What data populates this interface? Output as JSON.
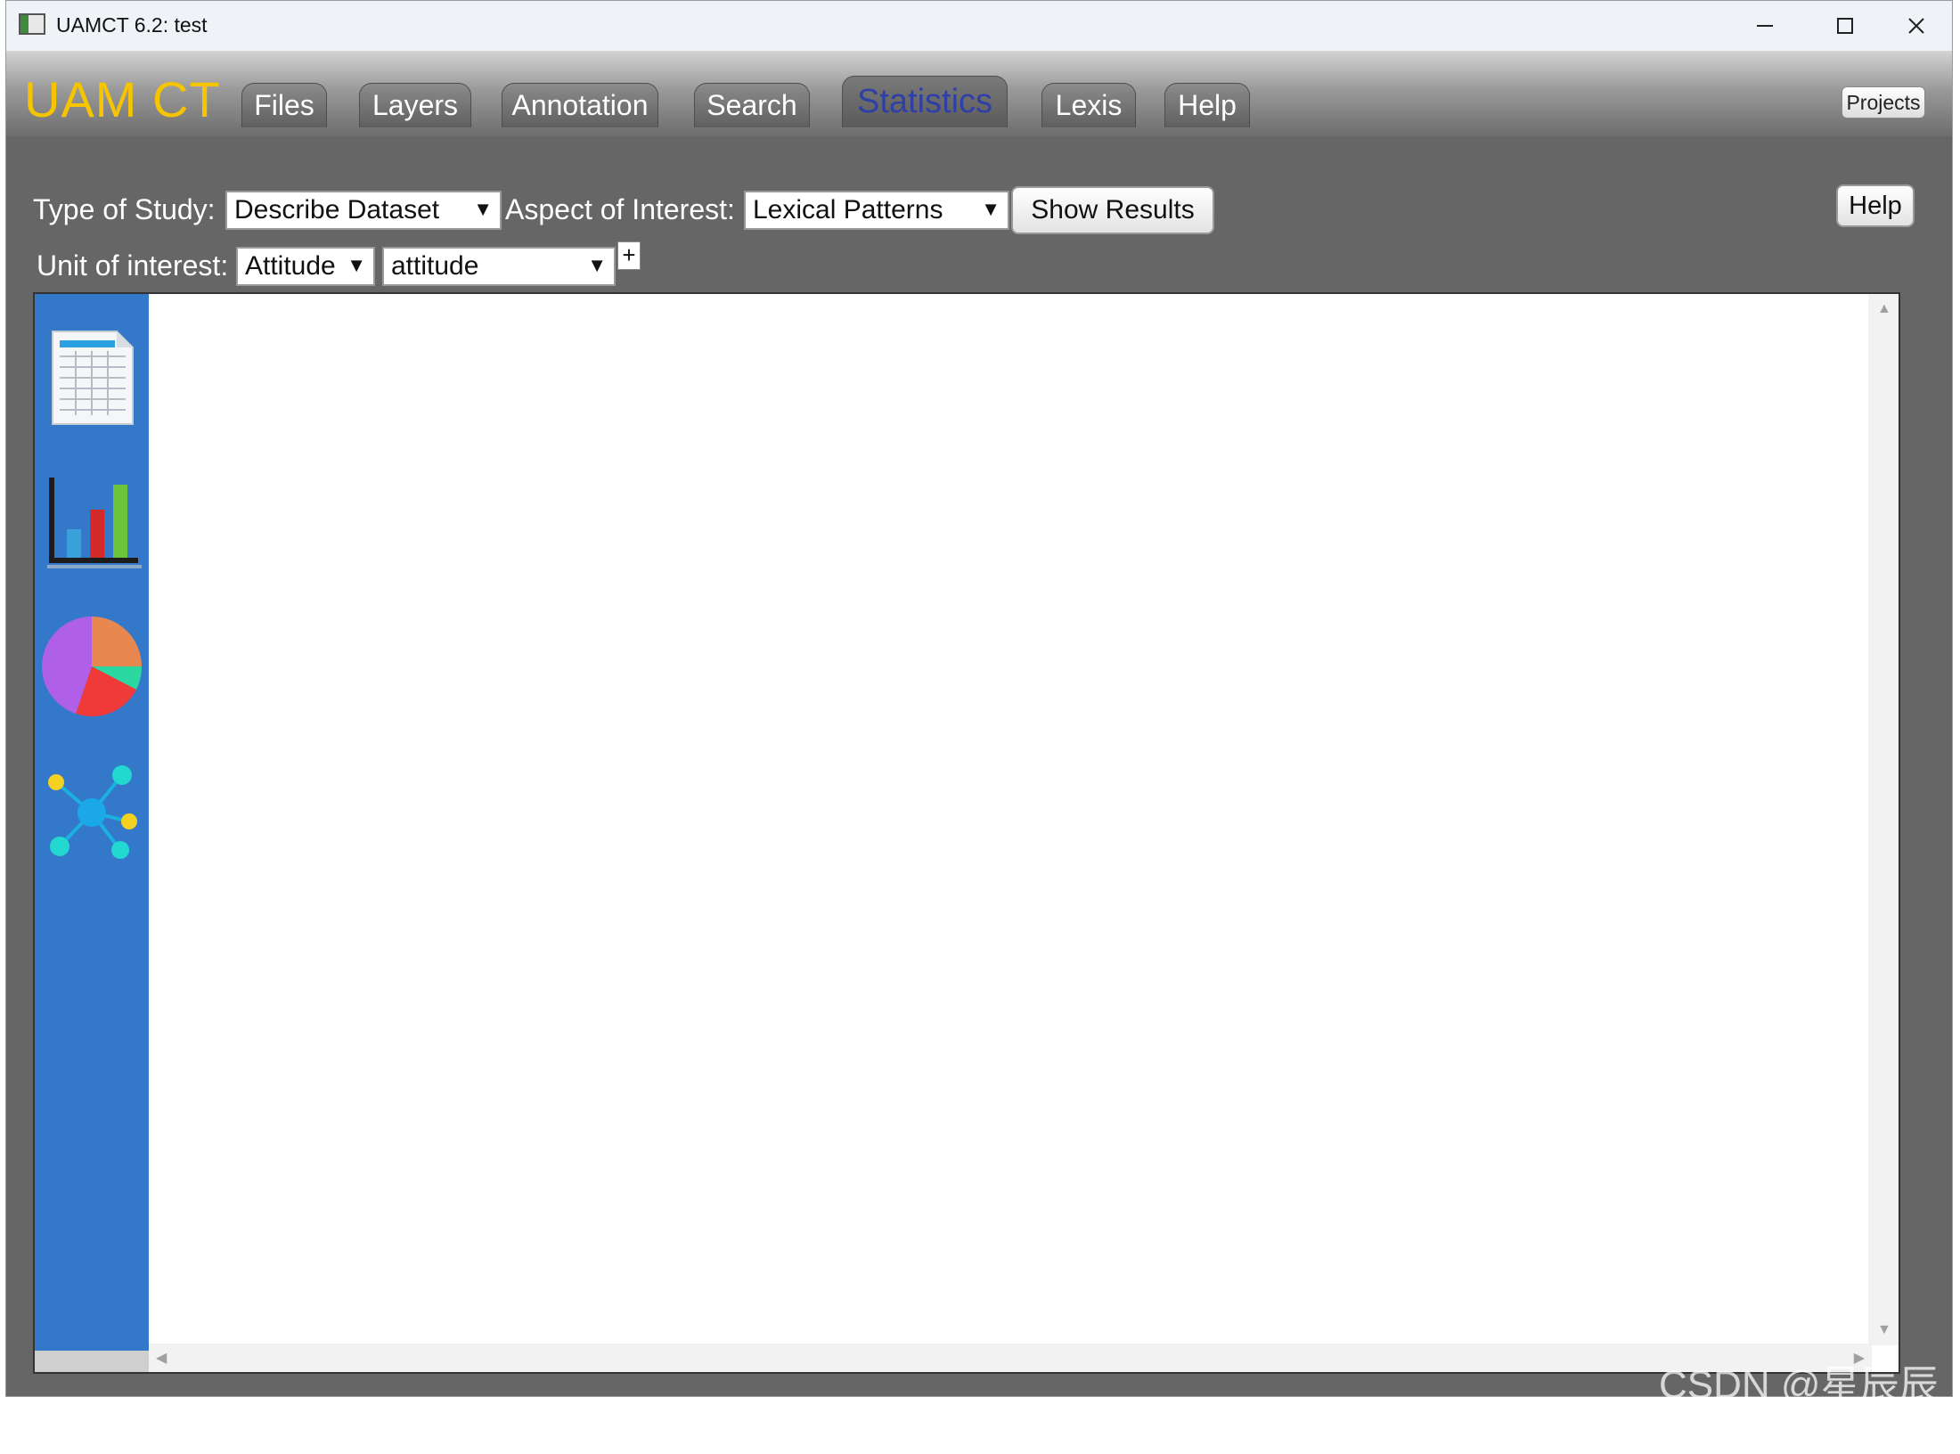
{
  "window": {
    "title": "UAMCT 6.2: test",
    "controls": {
      "minimize": "minimize",
      "maximize": "maximize",
      "close": "close"
    }
  },
  "header": {
    "logo": "UAM CT",
    "tabs": [
      {
        "label": "Files"
      },
      {
        "label": "Layers"
      },
      {
        "label": "Annotation"
      },
      {
        "label": "Search"
      },
      {
        "label": "Statistics",
        "active": true
      },
      {
        "label": "Lexis"
      },
      {
        "label": "Help"
      }
    ],
    "projects_label": "Projects"
  },
  "controls": {
    "type_of_study_label": "Type of Study:",
    "type_of_study_value": "Describe Dataset",
    "aspect_label": "Aspect of Interest:",
    "aspect_value": "Lexical Patterns",
    "show_results_label": "Show Results",
    "help_label": "Help",
    "unit_label": "Unit of interest:",
    "unit_value": "Attitude",
    "subunit_value": "attitude",
    "add_label": "+"
  },
  "sidebar": {
    "icons": [
      "table-icon",
      "bar-chart-icon",
      "pie-chart-icon",
      "network-icon"
    ]
  },
  "watermark": "CSDN @星辰辰ya",
  "colors": {
    "sidebar": "#3479c9",
    "logo": "#f6c400",
    "active_tab": "#2e3fa6",
    "panel": "#666666"
  }
}
